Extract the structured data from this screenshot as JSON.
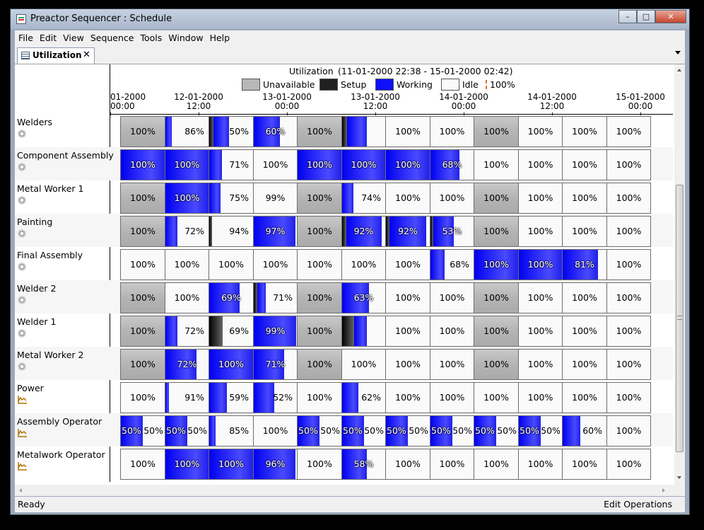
{
  "window": {
    "title": "Preactor Sequencer : Schedule",
    "minimize": "–",
    "maximize": "□",
    "close": "✕"
  },
  "menu": [
    "File",
    "Edit",
    "View",
    "Sequence",
    "Tools",
    "Window",
    "Help"
  ],
  "tab": {
    "label": "Utilization",
    "close": "✕"
  },
  "chart_header": {
    "title": "Utilization",
    "range": "(11-01-2000 22:38 - 15-01-2000 02:42)",
    "legend": [
      {
        "label": "Unavailable",
        "color": "#b8b8b8"
      },
      {
        "label": "Setup",
        "color": "#202020"
      },
      {
        "label": "Working",
        "color": "#1010f8"
      },
      {
        "label": "Idle",
        "color": "#fafafa"
      }
    ],
    "legend_marker": "100%",
    "time_ticks": [
      {
        "date": "01-2000",
        "time": "00:00"
      },
      {
        "date": "12-01-2000",
        "time": "12:00"
      },
      {
        "date": "13-01-2000",
        "time": "00:00"
      },
      {
        "date": "13-01-2000",
        "time": "12:00"
      },
      {
        "date": "14-01-2000",
        "time": "00:00"
      },
      {
        "date": "14-01-2000",
        "time": "12:00"
      },
      {
        "date": "15-01-2000",
        "time": "00:00"
      }
    ]
  },
  "rows": [
    {
      "name": "Welders",
      "icon": "gear-icon",
      "cells": [
        {
          "label": "100%",
          "unavailable": true,
          "working": 0
        },
        {
          "label": "86%",
          "working": 0.14
        },
        {
          "label": "50%",
          "setup": 0.1,
          "working": 0.35
        },
        {
          "label": "60%",
          "working": 0.6
        },
        {
          "label": "100%",
          "unavailable": true,
          "working": 0
        },
        {
          "label": "",
          "setup": 0.12,
          "working": 0.46
        },
        {
          "label": "100%",
          "working": 0
        },
        {
          "label": "100%",
          "working": 0
        },
        {
          "label": "100%",
          "unavailable": true,
          "working": 0
        },
        {
          "label": "100%",
          "working": 0
        },
        {
          "label": "100%",
          "working": 0
        },
        {
          "label": "100%",
          "working": 0
        }
      ]
    },
    {
      "name": "Component Assembly",
      "icon": "gear-icon",
      "cells": [
        {
          "label": "100%",
          "working": 1
        },
        {
          "label": "100%",
          "working": 1
        },
        {
          "label": "71%",
          "working": 0.29
        },
        {
          "label": "100%",
          "working": 0
        },
        {
          "label": "100%",
          "working": 1
        },
        {
          "label": "100%",
          "working": 1
        },
        {
          "label": "100%",
          "working": 1
        },
        {
          "label": "68%",
          "working": 0.68
        },
        {
          "label": "100%",
          "working": 0
        },
        {
          "label": "100%",
          "working": 0
        },
        {
          "label": "100%",
          "working": 0
        },
        {
          "label": "100%",
          "working": 0
        }
      ]
    },
    {
      "name": "Metal Worker 1",
      "icon": "gear-icon",
      "cells": [
        {
          "label": "100%",
          "unavailable": true,
          "working": 0
        },
        {
          "label": "100%",
          "working": 1
        },
        {
          "label": "75%",
          "working": 0.25
        },
        {
          "label": "99%",
          "working": 0
        },
        {
          "label": "100%",
          "unavailable": true,
          "working": 0
        },
        {
          "label": "74%",
          "working": 0.26
        },
        {
          "label": "100%",
          "working": 0
        },
        {
          "label": "100%",
          "working": 0
        },
        {
          "label": "100%",
          "unavailable": true,
          "working": 0
        },
        {
          "label": "100%",
          "working": 0
        },
        {
          "label": "100%",
          "working": 0
        },
        {
          "label": "100%",
          "working": 0
        }
      ]
    },
    {
      "name": "Painting",
      "icon": "gear-icon",
      "cells": [
        {
          "label": "100%",
          "unavailable": true,
          "working": 0
        },
        {
          "label": "72%",
          "working": 0.28
        },
        {
          "label": "94%",
          "setup": 0.06,
          "working": 0
        },
        {
          "label": "97%",
          "working": 0.97
        },
        {
          "label": "100%",
          "unavailable": true,
          "working": 0
        },
        {
          "label": "92%",
          "setup": 0.1,
          "working": 0.82
        },
        {
          "label": "92%",
          "setup": 0.08,
          "working": 0.84
        },
        {
          "label": "53%",
          "setup": 0.06,
          "working": 0.47
        },
        {
          "label": "100%",
          "unavailable": true,
          "working": 0
        },
        {
          "label": "100%",
          "working": 0
        },
        {
          "label": "100%",
          "working": 0
        },
        {
          "label": "100%",
          "working": 0
        }
      ]
    },
    {
      "name": "Final Assembly",
      "icon": "gear-icon",
      "cells": [
        {
          "label": "100%",
          "working": 0
        },
        {
          "label": "100%",
          "working": 0
        },
        {
          "label": "100%",
          "working": 0
        },
        {
          "label": "100%",
          "working": 0
        },
        {
          "label": "100%",
          "working": 0
        },
        {
          "label": "100%",
          "working": 0
        },
        {
          "label": "100%",
          "working": 0
        },
        {
          "label": "68%",
          "working": 0.32
        },
        {
          "label": "100%",
          "working": 1
        },
        {
          "label": "100%",
          "working": 1
        },
        {
          "label": "81%",
          "working": 0.81
        },
        {
          "label": "100%",
          "working": 0
        }
      ]
    },
    {
      "name": "Welder 2",
      "icon": "gear-icon",
      "cells": [
        {
          "label": "100%",
          "unavailable": true,
          "working": 0
        },
        {
          "label": "100%",
          "working": 0
        },
        {
          "label": "69%",
          "working": 0.69
        },
        {
          "label": "71%",
          "setup": 0.08,
          "working": 0.2
        },
        {
          "label": "100%",
          "unavailable": true,
          "working": 0
        },
        {
          "label": "63%",
          "working": 0.63
        },
        {
          "label": "100%",
          "working": 0
        },
        {
          "label": "100%",
          "working": 0
        },
        {
          "label": "100%",
          "unavailable": true,
          "working": 0
        },
        {
          "label": "100%",
          "working": 0
        },
        {
          "label": "100%",
          "working": 0
        },
        {
          "label": "100%",
          "working": 0
        }
      ]
    },
    {
      "name": "Welder 1",
      "icon": "gear-icon",
      "cells": [
        {
          "label": "100%",
          "unavailable": true,
          "working": 0
        },
        {
          "label": "72%",
          "working": 0.28
        },
        {
          "label": "69%",
          "setup": 0.3,
          "working": 0
        },
        {
          "label": "99%",
          "working": 0.99
        },
        {
          "label": "100%",
          "unavailable": true,
          "working": 0
        },
        {
          "label": "",
          "setup": 0.28,
          "working": 0.3
        },
        {
          "label": "100%",
          "working": 0
        },
        {
          "label": "100%",
          "working": 0
        },
        {
          "label": "100%",
          "unavailable": true,
          "working": 0
        },
        {
          "label": "100%",
          "working": 0
        },
        {
          "label": "100%",
          "working": 0
        },
        {
          "label": "100%",
          "working": 0
        }
      ]
    },
    {
      "name": "Metal Worker 2",
      "icon": "gear-icon",
      "cells": [
        {
          "label": "100%",
          "unavailable": true,
          "working": 0
        },
        {
          "label": "72%",
          "working": 0.72
        },
        {
          "label": "100%",
          "working": 1
        },
        {
          "label": "71%",
          "working": 0.71
        },
        {
          "label": "100%",
          "unavailable": true,
          "working": 0
        },
        {
          "label": "100%",
          "working": 0
        },
        {
          "label": "100%",
          "working": 0
        },
        {
          "label": "100%",
          "working": 0
        },
        {
          "label": "100%",
          "unavailable": true,
          "working": 0
        },
        {
          "label": "100%",
          "working": 0
        },
        {
          "label": "100%",
          "working": 0
        },
        {
          "label": "100%",
          "working": 0
        }
      ]
    },
    {
      "name": "Power",
      "icon": "chart-icon",
      "cells": [
        {
          "label": "100%",
          "working": 0
        },
        {
          "label": "91%",
          "working": 0.09
        },
        {
          "label": "59%",
          "working": 0.41
        },
        {
          "label": "52%",
          "working": 0.48
        },
        {
          "label": "100%",
          "working": 0
        },
        {
          "label": "62%",
          "working": 0.38
        },
        {
          "label": "100%",
          "working": 0
        },
        {
          "label": "100%",
          "working": 0
        },
        {
          "label": "100%",
          "working": 0
        },
        {
          "label": "100%",
          "working": 0
        },
        {
          "label": "100%",
          "working": 0
        },
        {
          "label": "100%",
          "working": 0
        }
      ]
    },
    {
      "name": "Assembly Operator",
      "icon": "chart-icon",
      "cells": [
        {
          "label": "50%",
          "label2": "50%",
          "working": 0.5
        },
        {
          "label": "50%",
          "label2": "50%",
          "working": 0.5
        },
        {
          "label": "85%",
          "working": 0.15
        },
        {
          "label": "100%",
          "working": 0
        },
        {
          "label": "50%",
          "label2": "50%",
          "working": 0.5
        },
        {
          "label": "50%",
          "label2": "50%",
          "working": 0.5
        },
        {
          "label": "50%",
          "label2": "50%",
          "working": 0.5
        },
        {
          "label": "50%",
          "label2": "50%",
          "working": 0.5
        },
        {
          "label": "50%",
          "label2": "50%",
          "working": 0.5
        },
        {
          "label": "50%",
          "label2": "50%",
          "working": 0.5
        },
        {
          "label": "60%",
          "working": 0.4
        },
        {
          "label": "100%",
          "working": 0
        }
      ]
    },
    {
      "name": "Metalwork Operator",
      "icon": "chart-icon",
      "cells": [
        {
          "label": "100%",
          "working": 0
        },
        {
          "label": "100%",
          "working": 1
        },
        {
          "label": "100%",
          "working": 1
        },
        {
          "label": "96%",
          "working": 0.96
        },
        {
          "label": "100%",
          "working": 0
        },
        {
          "label": "58%",
          "working": 0.58
        },
        {
          "label": "100%",
          "working": 0
        },
        {
          "label": "100%",
          "working": 0
        },
        {
          "label": "100%",
          "working": 0
        },
        {
          "label": "100%",
          "working": 0
        },
        {
          "label": "100%",
          "working": 0
        },
        {
          "label": "100%",
          "working": 0
        }
      ]
    }
  ],
  "status": {
    "left": "Ready",
    "right": "Edit Operations"
  }
}
